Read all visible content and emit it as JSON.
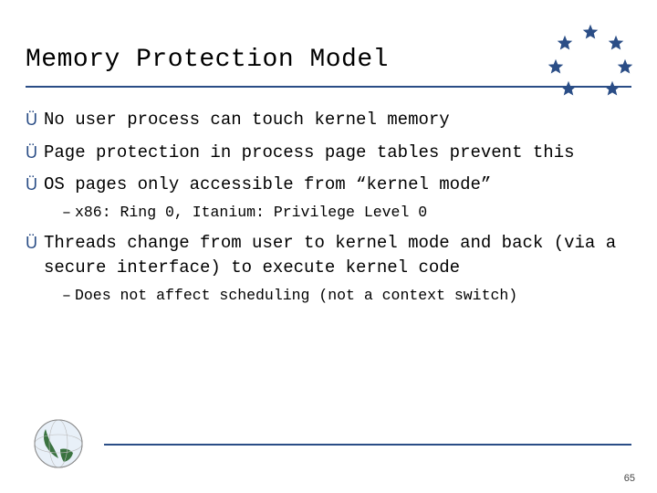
{
  "slide": {
    "title": "Memory Protection Model",
    "bullets": [
      {
        "level": 1,
        "text": "No user process can touch kernel memory"
      },
      {
        "level": 1,
        "text": "Page protection in process page tables prevent this"
      },
      {
        "level": 1,
        "text": "OS pages only accessible from “kernel mode”"
      },
      {
        "level": 2,
        "text": "x86:  Ring 0, Itanium: Privilege Level 0"
      },
      {
        "level": 1,
        "text": "Threads change from user to kernel mode and back (via a secure interface) to execute kernel code"
      },
      {
        "level": 2,
        "text": "Does not affect scheduling (not a context switch)"
      }
    ],
    "page_number": "65"
  },
  "glyphs": {
    "bullet_arrow": "Ü",
    "sub_dash": "–"
  },
  "colors": {
    "accent": "#2a4d86"
  }
}
